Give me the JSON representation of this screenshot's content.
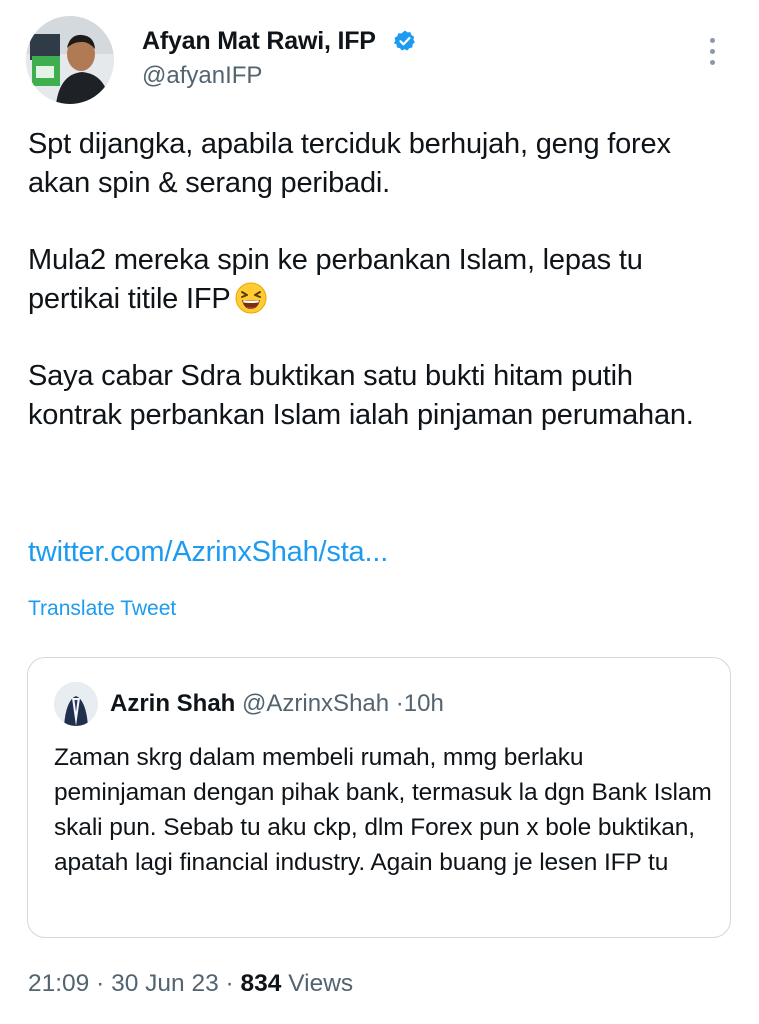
{
  "author": {
    "name": "Afyan Mat Rawi, IFP",
    "handle": "@afyanIFP",
    "verified": true,
    "avatar_icon": "profile-photo"
  },
  "tweet": {
    "paragraphs": [
      "Spt dijangka, apabila terciduk berhujah, geng forex akan spin & serang peribadi.",
      "Mula2 mereka spin ke perbankan Islam, lepas tu pertikai titile IFP",
      "Saya cabar Sdra buktikan satu bukti hitam putih kontrak perbankan Islam ialah pinjaman perumahan."
    ],
    "emoji": "grinning-squinting-face",
    "link": "twitter.com/AzrinxShah/sta...",
    "translate_label": "Translate Tweet"
  },
  "quote": {
    "name": "Azrin Shah",
    "handle": "@AzrinxShah",
    "separator": "·",
    "time": "10h",
    "text": "Zaman skrg dalam membeli rumah, mmg berlaku peminjaman dengan pihak bank, termasuk la dgn Bank Islam skali pun. Sebab tu aku ckp, dlm Forex pun x bole buktikan, apatah lagi financial industry. Again buang je lesen IFP tu"
  },
  "meta": {
    "time": "21:09",
    "separator": "·",
    "date": "30 Jun 23",
    "views_count": "834",
    "views_label": "Views"
  },
  "colors": {
    "link": "#1d9bf0",
    "secondary_text": "#536471",
    "border": "#cfd9de",
    "verified_badge": "#1d9bf0"
  }
}
